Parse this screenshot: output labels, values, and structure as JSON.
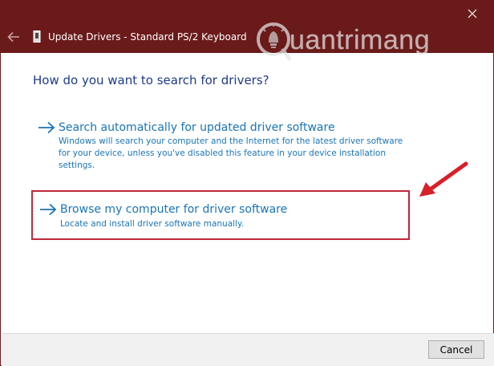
{
  "window": {
    "title": "Update Drivers - Standard PS/2 Keyboard",
    "back_icon": "back-arrow-icon",
    "close_icon": "close-icon",
    "device_icon": "device-icon"
  },
  "watermark": {
    "text": "uantrimang"
  },
  "main": {
    "question": "How do you want to search for drivers?",
    "options": [
      {
        "title": "Search automatically for updated driver software",
        "description": "Windows will search your computer and the Internet for the latest driver software for your device, unless you've disabled this feature in your device installation settings."
      },
      {
        "title": "Browse my computer for driver software",
        "description": "Locate and install driver software manually."
      }
    ]
  },
  "footer": {
    "cancel_label": "Cancel"
  },
  "colors": {
    "titlebar": "#6b1a1a",
    "heading": "#1e3a8a",
    "link": "#1a74b8",
    "highlight_border": "#c0283a",
    "annotation_arrow": "#d81f2a"
  }
}
